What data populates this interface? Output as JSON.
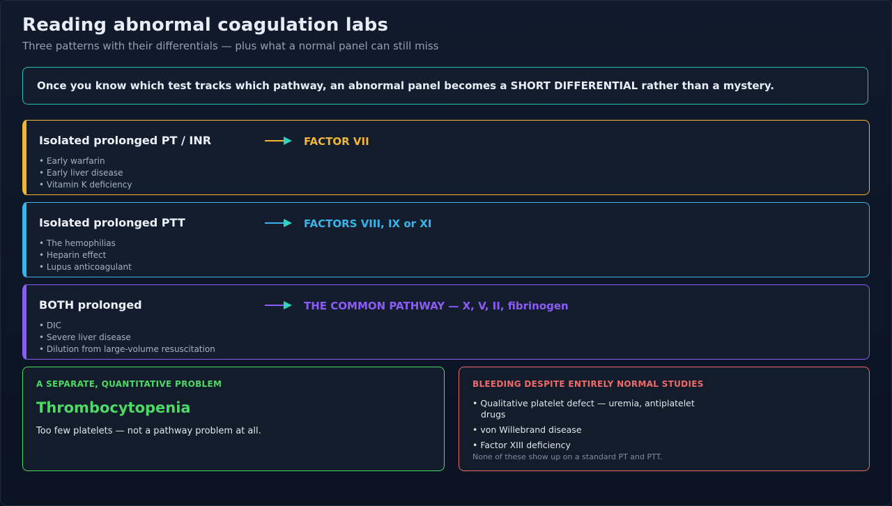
{
  "header": {
    "title": "Reading abnormal coagulation labs",
    "subtitle": "Three patterns with their differentials — plus what a normal panel can still miss"
  },
  "banner": {
    "text": "Once you know which test tracks which pathway, an abnormal panel becomes a SHORT DIFFERENTIAL rather than a mystery."
  },
  "patterns": [
    {
      "label": "Isolated prolonged PT / INR",
      "target": "FACTOR VII",
      "color": "#f2b632",
      "causes": [
        "Early warfarin",
        "Early liver disease",
        "Vitamin K deficiency"
      ]
    },
    {
      "label": "Isolated prolonged PTT",
      "target": "FACTORS VIII, IX or XI",
      "color": "#38b6ea",
      "causes": [
        "The hemophilias",
        "Heparin effect",
        "Lupus anticoagulant"
      ]
    },
    {
      "label": "BOTH prolonged",
      "target": "THE COMMON PATHWAY — X, V, II, fibrinogen",
      "color": "#8b5cf6",
      "causes": [
        "DIC",
        "Severe liver disease",
        "Dilution from large-volume resuscitation"
      ]
    }
  ],
  "arrow_head_color": "#2dd4bf",
  "quantitative": {
    "kicker": "A SEPARATE, QUANTITATIVE PROBLEM",
    "title": "Thrombocytopenia",
    "description": "Too few platelets — not a pathway problem at all.",
    "color": "#4cd964"
  },
  "normal_studies": {
    "kicker": "BLEEDING DESPITE ENTIRELY NORMAL STUDIES",
    "items": [
      "Qualitative platelet defect — uremia, antiplatelet drugs",
      "von Willebrand disease",
      "Factor XIII deficiency"
    ],
    "note": "None of these show up on a standard PT and PTT.",
    "color": "#f06a6a"
  }
}
